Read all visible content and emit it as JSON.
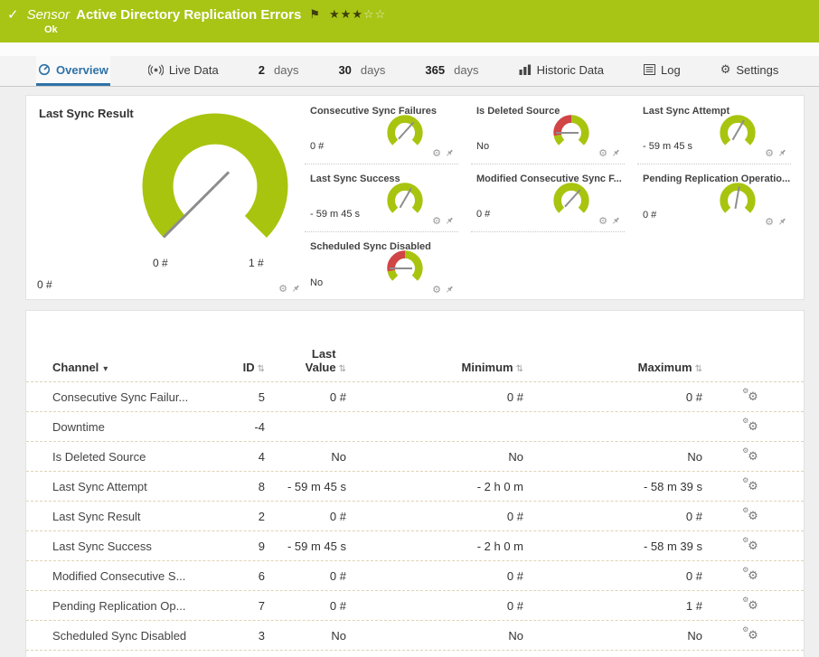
{
  "colors": {
    "header_green": "#a8c415",
    "gauge_green": "#a9c40f",
    "binary_red": "#d04545",
    "accent_blue": "#2f72a8",
    "row_divider": "#dfd3b5"
  },
  "icons": {
    "check": "✓",
    "flag": "⚑",
    "gear": "⚙",
    "dropdown": "▾",
    "sort": "⇅"
  },
  "header": {
    "kind": "Sensor",
    "title": "Active Directory Replication Errors",
    "status": "Ok",
    "stars_filled_count": 3,
    "stars_total": 5,
    "stars_filled_glyphs": "★★★",
    "stars_empty_glyphs": "☆☆"
  },
  "tabs": {
    "overview": "Overview",
    "live_data": "Live Data",
    "day_tabs": [
      {
        "num": "2",
        "word": "days"
      },
      {
        "num": "30",
        "word": "days"
      },
      {
        "num": "365",
        "word": "days"
      }
    ],
    "historic": "Historic Data",
    "log": "Log",
    "settings": "Settings"
  },
  "gauge_panel": {
    "main_gauge": {
      "title": "Last Sync Result",
      "value": "0 #",
      "scale_min": "0 #",
      "scale_max": "1 #",
      "needle_deg": -135
    },
    "small_gauges": [
      {
        "title": "Consecutive Sync Failures",
        "value": "0 #",
        "type": "standard",
        "needle_deg": 42
      },
      {
        "title": "Is Deleted Source",
        "value": "No",
        "type": "binary",
        "needle_deg": -90
      },
      {
        "title": "Last Sync Attempt",
        "value": "- 59 m 45 s",
        "type": "standard",
        "needle_deg": 30
      },
      {
        "title": "Last Sync Success",
        "value": "- 59 m 45 s",
        "type": "standard",
        "needle_deg": 30
      },
      {
        "title": "Modified Consecutive Sync F...",
        "value": "0 #",
        "type": "standard",
        "needle_deg": 42
      },
      {
        "title": "Pending Replication Operatio...",
        "value": "0 #",
        "type": "standard",
        "needle_deg": 10
      },
      {
        "title": "Scheduled Sync Disabled",
        "value": "No",
        "type": "binary",
        "needle_deg": -90
      }
    ]
  },
  "table": {
    "columns": {
      "channel": "Channel",
      "id": "ID",
      "last_value": "Last Value",
      "minimum": "Minimum",
      "maximum": "Maximum"
    },
    "rows": [
      {
        "channel": "Consecutive Sync Failur...",
        "id": "5",
        "last": "0 #",
        "min": "0 #",
        "max": "0 #"
      },
      {
        "channel": "Downtime",
        "id": "-4",
        "last": "",
        "min": "",
        "max": ""
      },
      {
        "channel": "Is Deleted Source",
        "id": "4",
        "last": "No",
        "min": "No",
        "max": "No"
      },
      {
        "channel": "Last Sync Attempt",
        "id": "8",
        "last": "- 59 m 45 s",
        "min": "- 2 h 0 m",
        "max": "- 58 m 39 s"
      },
      {
        "channel": "Last Sync Result",
        "id": "2",
        "last": "0 #",
        "min": "0 #",
        "max": "0 #"
      },
      {
        "channel": "Last Sync Success",
        "id": "9",
        "last": "- 59 m 45 s",
        "min": "- 2 h 0 m",
        "max": "- 58 m 39 s"
      },
      {
        "channel": "Modified Consecutive S...",
        "id": "6",
        "last": "0 #",
        "min": "0 #",
        "max": "0 #"
      },
      {
        "channel": "Pending Replication Op...",
        "id": "7",
        "last": "0 #",
        "min": "0 #",
        "max": "1 #"
      },
      {
        "channel": "Scheduled Sync Disabled",
        "id": "3",
        "last": "No",
        "min": "No",
        "max": "No"
      }
    ]
  }
}
